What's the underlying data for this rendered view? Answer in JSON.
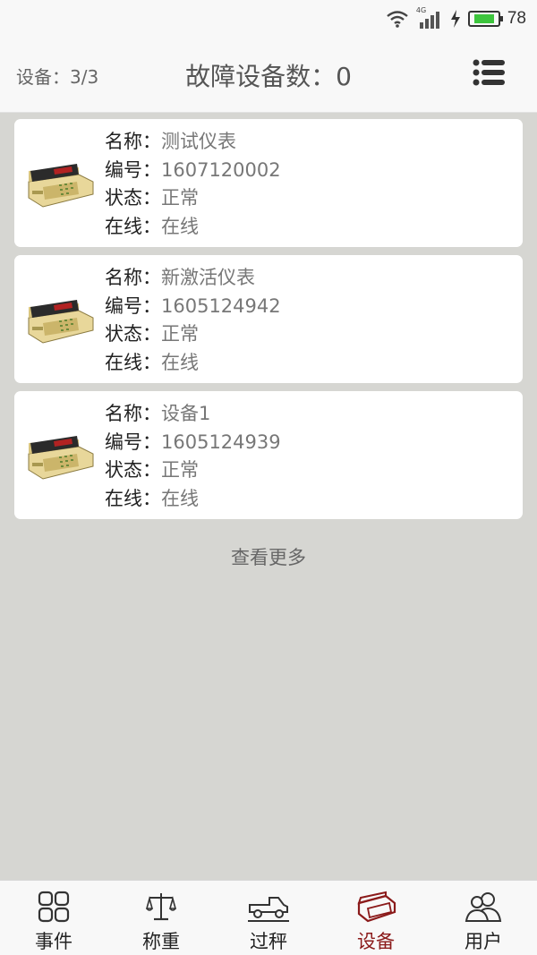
{
  "status_bar": {
    "network": "4G",
    "battery_level": "78",
    "battery_color": "#3dc53d"
  },
  "header": {
    "device_count": "设备：3/3",
    "title": "故障设备数：0",
    "menu_icon": "list-menu-icon"
  },
  "devices": [
    {
      "name_label": "名称：",
      "name": "测试仪表",
      "id_label": "编号：",
      "id": "1607120002",
      "status_label": "状态：",
      "status": "正常",
      "online_label": "在线：",
      "online": "在线"
    },
    {
      "name_label": "名称：",
      "name": "新激活仪表",
      "id_label": "编号：",
      "id": "1605124942",
      "status_label": "状态：",
      "status": "正常",
      "online_label": "在线：",
      "online": "在线"
    },
    {
      "name_label": "名称：",
      "name": "设备1",
      "id_label": "编号：",
      "id": "1605124939",
      "status_label": "状态：",
      "status": "正常",
      "online_label": "在线：",
      "online": "在线"
    }
  ],
  "view_more": "查看更多",
  "tabs": [
    {
      "label": "事件",
      "icon": "grid-icon"
    },
    {
      "label": "称重",
      "icon": "scale-icon"
    },
    {
      "label": "过秤",
      "icon": "truck-icon"
    },
    {
      "label": "设备",
      "icon": "device-icon",
      "active": true
    },
    {
      "label": "用户",
      "icon": "users-icon"
    }
  ],
  "colors": {
    "accent": "#8b1a1a",
    "background": "#d6d6d2"
  }
}
